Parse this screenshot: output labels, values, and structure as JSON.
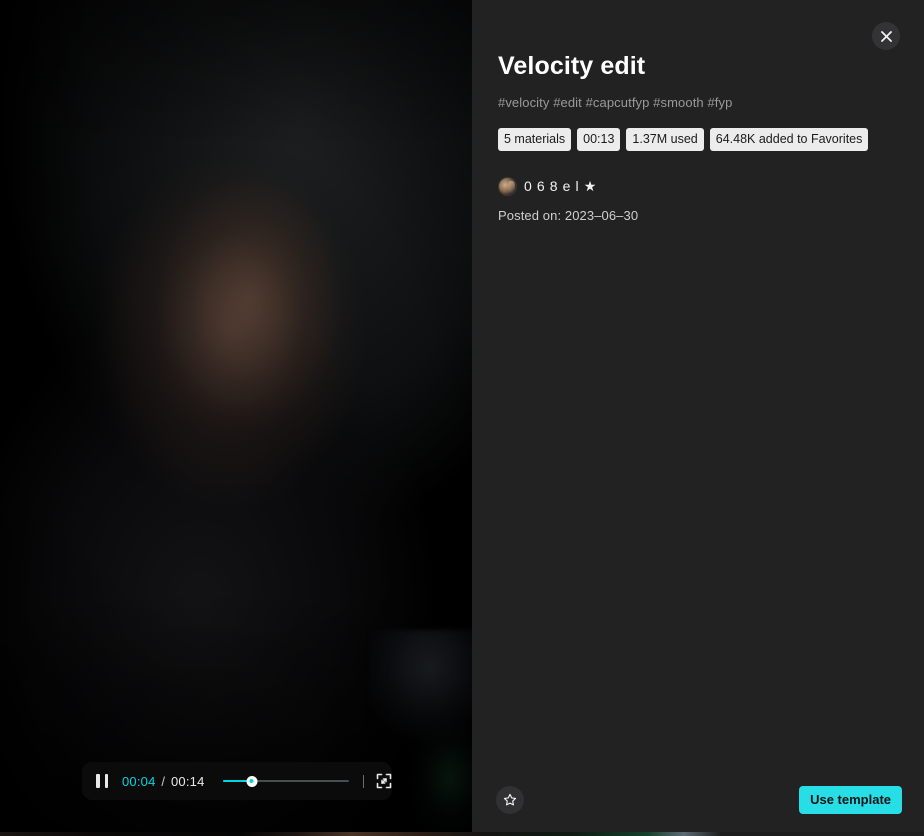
{
  "modal": {
    "close_icon": "close-icon"
  },
  "video": {
    "controls": {
      "play_state_icon": "pause-icon",
      "current_time": "00:04",
      "separator": "/",
      "duration": "00:14",
      "progress_percent": 23,
      "fullscreen_icon": "fullscreen-icon"
    }
  },
  "details": {
    "title": "Velocity edit",
    "hashtags": "#velocity #edit #capcutfyp #smooth #fyp",
    "tags": [
      "5 materials",
      "00:13",
      "1.37M used",
      "64.48K added to Favorites"
    ],
    "author": {
      "avatar_icon": "avatar",
      "name": "0 6 8 e l ★"
    },
    "posted_on": "Posted on: 2023–06–30"
  },
  "bottom_bar": {
    "favorite_icon": "star-outline-icon",
    "use_template_label": "Use template"
  },
  "colors": {
    "accent": "#27dde6",
    "progress": "#00d6e0",
    "panel_bg": "#222222",
    "tag_bg": "#ececec",
    "tag_text": "#1a1a1a"
  }
}
